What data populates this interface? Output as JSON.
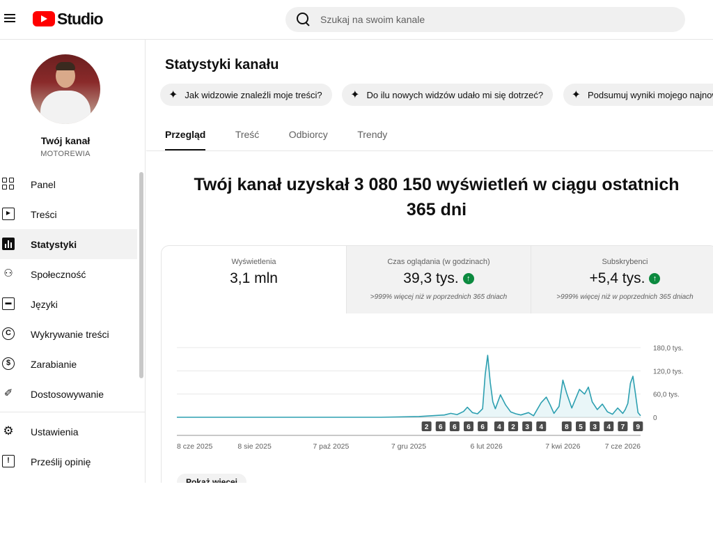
{
  "app": {
    "logo_text": "Studio"
  },
  "search": {
    "placeholder": "Szukaj na swoim kanale"
  },
  "channel": {
    "name": "Twój kanał",
    "handle": "MOTOREWIA"
  },
  "sidebar": {
    "items": [
      {
        "label": "Panel",
        "icon": "dashboard-icon"
      },
      {
        "label": "Treści",
        "icon": "content-icon"
      },
      {
        "label": "Statystyki",
        "icon": "analytics-icon",
        "active": true
      },
      {
        "label": "Społeczność",
        "icon": "community-icon"
      },
      {
        "label": "Języki",
        "icon": "subtitles-icon"
      },
      {
        "label": "Wykrywanie treści",
        "icon": "copyright-icon"
      },
      {
        "label": "Zarabianie",
        "icon": "dollar-icon"
      },
      {
        "label": "Dostosowywanie",
        "icon": "magic-wand-icon"
      }
    ],
    "bottom_items": [
      {
        "label": "Ustawienia",
        "icon": "gear-icon"
      },
      {
        "label": "Prześlij opinię",
        "icon": "feedback-icon"
      }
    ]
  },
  "main": {
    "title": "Statystyki kanału",
    "chips": [
      "Jak widzowie znaleźli moje treści?",
      "Do ilu nowych widzów udało mi się dotrzeć?",
      "Podsumuj wyniki mojego najnows"
    ],
    "tabs": [
      "Przegląd",
      "Treść",
      "Odbiorcy",
      "Trendy"
    ],
    "active_tab": "Przegląd",
    "headline_line1": "Twój kanał uzyskał 3 080 150 wyświetleń w ciągu ostatnich",
    "headline_line2": "365 dni",
    "show_more": "Pokaż więcej"
  },
  "metrics": [
    {
      "label": "Wyświetlenia",
      "value": "3,1 mln",
      "note": ""
    },
    {
      "label": "Czas oglądania (w godzinach)",
      "value": "39,3 tys.",
      "note": ">999% więcej niż w poprzednich 365 dniach",
      "trend": "up"
    },
    {
      "label": "Subskrybenci",
      "value": "+5,4 tys.",
      "note": ">999% więcej niż w poprzednich 365 dniach",
      "trend": "up"
    }
  ],
  "colors": {
    "line": "#2c9fb0",
    "area": "#d7eef2",
    "trend_up": "#0c8a3f",
    "accent": "#ff0000"
  },
  "chart_data": {
    "type": "line",
    "y_tick_labels": [
      "180,0 tys.",
      "120,0 tys.",
      "60,0 tys.",
      "0"
    ],
    "y_ticks": [
      180000,
      120000,
      60000,
      0
    ],
    "ylim": [
      0,
      180000
    ],
    "x_tick_labels": [
      "8 cze 2025",
      "8 sie 2025",
      "7 paź 2025",
      "7 gru 2025",
      "6 lut 2026",
      "7 kwi 2026",
      "7 cze 2026"
    ],
    "x_tick_days": [
      0,
      61,
      121,
      182,
      243,
      303,
      364
    ],
    "series": [
      {
        "x_days": [
          0,
          40,
          80,
          120,
          160,
          190,
          200,
          210,
          215,
          220,
          225,
          228,
          232,
          236,
          240,
          242,
          244,
          246,
          248,
          250,
          254,
          258,
          262,
          266,
          270,
          276,
          280,
          286,
          290,
          293,
          296,
          300,
          303,
          306,
          310,
          313,
          316,
          320,
          323,
          326,
          330,
          334,
          338,
          342,
          346,
          350,
          352,
          354,
          356,
          358,
          360,
          362,
          364
        ],
        "values": [
          0,
          0,
          0,
          0,
          0,
          2000,
          4000,
          6000,
          10000,
          7000,
          15000,
          26000,
          12000,
          9000,
          22000,
          110000,
          160000,
          90000,
          40000,
          22000,
          58000,
          32000,
          14000,
          9000,
          6000,
          12000,
          4000,
          38000,
          52000,
          32000,
          10000,
          28000,
          96000,
          62000,
          24000,
          48000,
          72000,
          60000,
          78000,
          40000,
          20000,
          34000,
          14000,
          8000,
          24000,
          10000,
          20000,
          36000,
          88000,
          106000,
          60000,
          12000,
          4000
        ]
      }
    ],
    "markers": [
      {
        "label": "2",
        "day": 196
      },
      {
        "label": "6",
        "day": 207
      },
      {
        "label": "6",
        "day": 218
      },
      {
        "label": "6",
        "day": 229
      },
      {
        "label": "6",
        "day": 240
      },
      {
        "label": "4",
        "day": 253
      },
      {
        "label": "2",
        "day": 264
      },
      {
        "label": "3",
        "day": 275
      },
      {
        "label": "4",
        "day": 286
      },
      {
        "label": "8",
        "day": 306
      },
      {
        "label": "5",
        "day": 317
      },
      {
        "label": "3",
        "day": 328
      },
      {
        "label": "4",
        "day": 339
      },
      {
        "label": "7",
        "day": 350
      },
      {
        "label": "9",
        "day": 362
      }
    ]
  }
}
